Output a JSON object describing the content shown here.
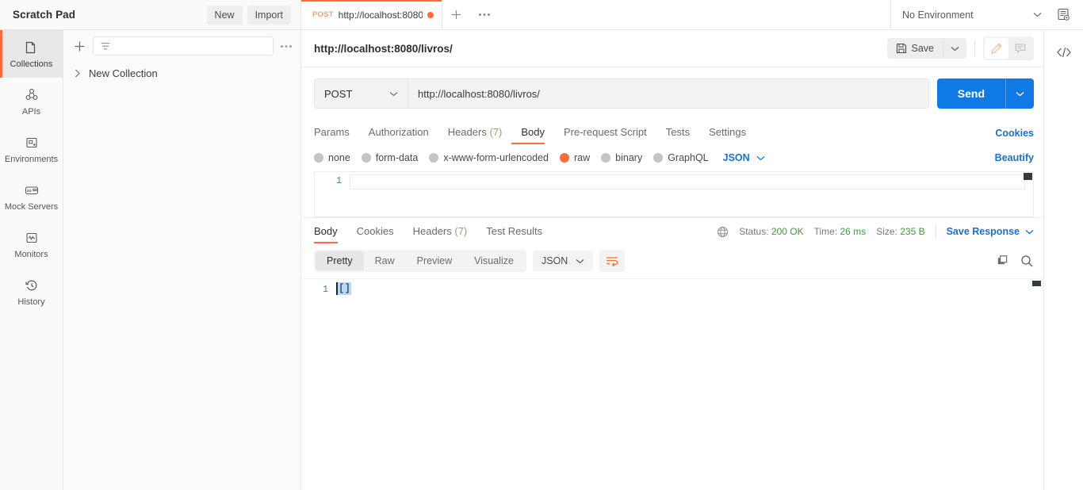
{
  "workspace": {
    "title": "Scratch Pad",
    "new_label": "New",
    "import_label": "Import"
  },
  "tab": {
    "method": "POST",
    "name": "http://localhost:8080/",
    "unsaved_dot": true,
    "new_tab_icon": "plus-icon",
    "more_icon": "ellipsis-icon"
  },
  "environment": {
    "selected": "No Environment",
    "caret_icon": "chevron-down-icon",
    "eye_icon": "environment-quick-look-icon"
  },
  "rail": {
    "items": [
      {
        "label": "Collections",
        "icon": "collections-icon",
        "active": true
      },
      {
        "label": "APIs",
        "icon": "apis-icon",
        "active": false
      },
      {
        "label": "Environments",
        "icon": "environments-icon",
        "active": false
      },
      {
        "label": "Mock Servers",
        "icon": "mock-servers-icon",
        "active": false
      },
      {
        "label": "Monitors",
        "icon": "monitors-icon",
        "active": false
      },
      {
        "label": "History",
        "icon": "history-icon",
        "active": false
      }
    ]
  },
  "sidebar": {
    "add_icon": "plus-icon",
    "filter_icon": "filter-icon",
    "filter_placeholder": "",
    "more_icon": "ellipsis-icon",
    "collections": [
      {
        "name": "New Collection",
        "expanded": false
      }
    ]
  },
  "request": {
    "title": "http://localhost:8080/livros/",
    "save_label": "Save",
    "save_icon": "save-icon",
    "save_caret_icon": "chevron-down-icon",
    "edit_icon": "pencil-icon",
    "comment_icon": "comment-icon",
    "method": "POST",
    "method_caret_icon": "chevron-down-icon",
    "url": "http://localhost:8080/livros/",
    "send_label": "Send",
    "send_caret_icon": "chevron-down-icon",
    "send_color": "#0f7ae5",
    "tabs": [
      {
        "label": "Params",
        "count": "",
        "active": false
      },
      {
        "label": "Authorization",
        "count": "",
        "active": false
      },
      {
        "label": "Headers",
        "count": "(7)",
        "active": false
      },
      {
        "label": "Body",
        "count": "",
        "active": true
      },
      {
        "label": "Pre-request Script",
        "count": "",
        "active": false
      },
      {
        "label": "Tests",
        "count": "",
        "active": false
      },
      {
        "label": "Settings",
        "count": "",
        "active": false
      }
    ],
    "cookies_link": "Cookies",
    "body_types": [
      {
        "label": "none",
        "selected": false
      },
      {
        "label": "form-data",
        "selected": false
      },
      {
        "label": "x-www-form-urlencoded",
        "selected": false
      },
      {
        "label": "raw",
        "selected": true
      },
      {
        "label": "binary",
        "selected": false
      },
      {
        "label": "GraphQL",
        "selected": false
      }
    ],
    "body_format": "JSON",
    "body_format_caret_icon": "chevron-down-icon",
    "beautify_link": "Beautify",
    "editor": {
      "line_numbers": [
        "1"
      ],
      "content": ""
    }
  },
  "response": {
    "tabs": [
      {
        "label": "Body",
        "count": "",
        "active": true
      },
      {
        "label": "Cookies",
        "count": "",
        "active": false
      },
      {
        "label": "Headers",
        "count": "(7)",
        "active": false
      },
      {
        "label": "Test Results",
        "count": "",
        "active": false
      }
    ],
    "globe_icon": "globe-icon",
    "status_label": "Status:",
    "status_value": "200 OK",
    "time_label": "Time:",
    "time_value": "26 ms",
    "size_label": "Size:",
    "size_value": "235 B",
    "save_response_label": "Save Response",
    "save_response_caret_icon": "chevron-down-icon",
    "view_modes": [
      {
        "label": "Pretty",
        "active": true
      },
      {
        "label": "Raw",
        "active": false
      },
      {
        "label": "Preview",
        "active": false
      },
      {
        "label": "Visualize",
        "active": false
      }
    ],
    "format": "JSON",
    "format_caret_icon": "chevron-down-icon",
    "wrap_icon": "wrap-text-icon",
    "copy_icon": "copy-icon",
    "search_icon": "search-icon",
    "body": {
      "line_numbers": [
        "1"
      ],
      "content": "[]"
    }
  },
  "right_rail": {
    "code_icon": "code-snippet-icon"
  },
  "colors": {
    "accent_orange": "#ff6c37",
    "link_blue": "#1a6fd4",
    "send_blue": "#0f7ae5",
    "status_green": "#3d9a3d"
  }
}
